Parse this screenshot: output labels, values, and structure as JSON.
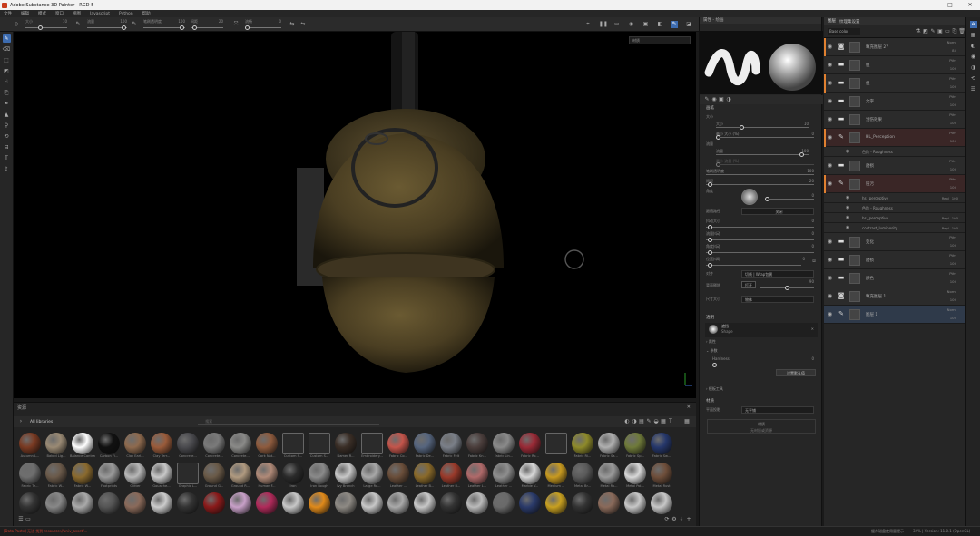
{
  "window": {
    "title": "Adobe Substance 3D Painter - RGD-5",
    "controls": [
      "—",
      "□",
      "✕"
    ]
  },
  "menu": [
    "文件",
    "编辑",
    "模式",
    "窗口",
    "视图",
    "Javascript",
    "Python",
    "帮助"
  ],
  "toolbar": {
    "sliders": [
      {
        "label": "大小",
        "value": "10"
      },
      {
        "label": "流量",
        "value": "100"
      },
      {
        "label": "笔刷透明度",
        "value": "100"
      },
      {
        "label": "间距",
        "value": "20"
      },
      {
        "label": "流畅",
        "value": "0"
      }
    ]
  },
  "viewport": {
    "dropdown": "材质"
  },
  "shelf": {
    "title": "资源",
    "library": "All libraries",
    "search_placeholder": "搜索",
    "row1": [
      {
        "label": "Autumn L...",
        "color": "#7a3a22"
      },
      {
        "label": "Baked Lig...",
        "color": "#9a8a74"
      },
      {
        "label": "Balance Contrast",
        "color": "#ffffff"
      },
      {
        "label": "Carbon Fi...",
        "color": "#111111"
      },
      {
        "label": "Clay Earl...",
        "color": "#8e6a4e"
      },
      {
        "label": "Clay Terr...",
        "color": "#9a5b3a"
      },
      {
        "label": "Concrete...",
        "color": "#4a4a4e"
      },
      {
        "label": "Concrete...",
        "color": "#7a7a7a"
      },
      {
        "label": "Concrete...",
        "color": "#8a8a88"
      },
      {
        "label": "Cork Nat...",
        "color": "#8e5b3e"
      },
      {
        "label": "Custom S...",
        "color": "#2b2b2b"
      },
      {
        "label": "Custom S...",
        "color": "#2b2b2b"
      },
      {
        "label": "Damer R...",
        "color": "#3a2e26"
      },
      {
        "label": "Embroidery...",
        "color": "#2b2b2b"
      },
      {
        "label": "Fabric Co...",
        "color": "#c4554b"
      },
      {
        "label": "Fabric De...",
        "color": "#56657e"
      },
      {
        "label": "Fabric Felt",
        "color": "#7a7f88"
      },
      {
        "label": "Fabric Kn...",
        "color": "#4b3e3c"
      },
      {
        "label": "Fabric Lin...",
        "color": "#8a8a8a"
      },
      {
        "label": "Fabric Ro...",
        "color": "#9a2a36"
      },
      {
        "label": "",
        "color": "#2b2b2b"
      },
      {
        "label": "Fabric Ri...",
        "color": "#8e8a2a"
      },
      {
        "label": "Fabric Sa...",
        "color": "#b0b0b0"
      },
      {
        "label": "Fabric Sp...",
        "color": "#6f7a3a"
      },
      {
        "label": "Fabric Sw...",
        "color": "#25376b"
      }
    ],
    "row2": [
      {
        "label": "Fabric Te...",
        "color": "#6e6e6e"
      },
      {
        "label": "Fabric W...",
        "color": "#6b5a4a"
      },
      {
        "label": "Fabric W...",
        "color": "#8a6a2e"
      },
      {
        "label": "Footprints",
        "color": "#9a9a9a"
      },
      {
        "label": "Glitter",
        "color": "#b8b8b8"
      },
      {
        "label": "Gouache...",
        "color": "#c8c8c8"
      },
      {
        "label": "Graphic L...",
        "color": "#2b2b2b"
      },
      {
        "label": "Ground G...",
        "color": "#6a5a48"
      },
      {
        "label": "Ground R...",
        "color": "#b09a80"
      },
      {
        "label": "Human F...",
        "color": "#b08a78"
      },
      {
        "label": "Iron",
        "color": "#2a2a2a"
      },
      {
        "label": "Iron Rough",
        "color": "#8a8a8a"
      },
      {
        "label": "Ivy Branch",
        "color": "#c8c8c8"
      },
      {
        "label": "Large Ro...",
        "color": "#a8a8a8"
      },
      {
        "label": "Leather ...",
        "color": "#6a4e3a"
      },
      {
        "label": "Leather B...",
        "color": "#8a6a2a"
      },
      {
        "label": "Leather R...",
        "color": "#9a3a2a"
      },
      {
        "label": "Leather L...",
        "color": "#b06a6a"
      },
      {
        "label": "Leather ...",
        "color": "#8e8e8e"
      },
      {
        "label": "Marble V...",
        "color": "#d8d8d8"
      },
      {
        "label": "Medium ...",
        "color": "#c89a20"
      },
      {
        "label": "Metal Br...",
        "color": "#5a5a5a"
      },
      {
        "label": "Metal Ro...",
        "color": "#9a9a9a"
      },
      {
        "label": "Metal Pol...",
        "color": "#d8d8d8"
      },
      {
        "label": "Metal Rust",
        "color": "#6e4e3a"
      }
    ],
    "row3": [
      {
        "color": "#333333"
      },
      {
        "color": "#888888"
      },
      {
        "color": "#aaaaaa"
      },
      {
        "color": "#555555"
      },
      {
        "color": "#8a6a5a"
      },
      {
        "color": "#cccccc"
      },
      {
        "color": "#333333"
      },
      {
        "color": "#8a1a1a"
      },
      {
        "color": "#c8a0c8"
      },
      {
        "color": "#b02a5a"
      },
      {
        "color": "#c8c8c8"
      },
      {
        "color": "#e08a1a"
      },
      {
        "color": "#8e8a84"
      },
      {
        "color": "#c8c8c8"
      },
      {
        "color": "#aaaaaa"
      },
      {
        "color": "#c8c8c8"
      },
      {
        "color": "#333333"
      },
      {
        "color": "#bbbbbb"
      },
      {
        "color": "#6a6a6a"
      },
      {
        "color": "#2a3a6a"
      },
      {
        "color": "#c8a020"
      },
      {
        "color": "#333333"
      },
      {
        "color": "#8a6a5a"
      },
      {
        "color": "#c8c8c8"
      },
      {
        "color": "#c8c8c8"
      }
    ]
  },
  "status": {
    "left": "[Data Paste] 无法 找到 resource://univ_asset/...",
    "right1": "缓存磁盘使用量提示",
    "right2": "32% | Version: 11.0.1 (OpenGL)"
  },
  "properties": {
    "header": "属性 - 绘画",
    "section_brush": "画笔",
    "size_label": "大小",
    "size_row": {
      "k": "大小",
      "v": "10"
    },
    "size_jitter": {
      "k": "最小 大小 (%)",
      "v": "0"
    },
    "flow_label": "流量",
    "flow_row": {
      "k": "流量",
      "v": "100"
    },
    "flow_jitter": {
      "k": "最小 流量 (%)",
      "v": ""
    },
    "opacity": {
      "k": "笔刷透明度",
      "v": "100"
    },
    "spacing": {
      "k": "间距",
      "v": "20"
    },
    "angle": {
      "k": "角度",
      "v": "0"
    },
    "follow_path": {
      "k": "跟随路径",
      "v": "关闭"
    },
    "size_jitter2": {
      "k": "抖动大小",
      "v": "0"
    },
    "flow_jitter2": {
      "k": "流量抖动",
      "v": "0"
    },
    "angle_jitter": {
      "k": "角度抖动",
      "v": "0"
    },
    "pos_jitter": {
      "k": "位置抖动",
      "v": "0"
    },
    "alignment": {
      "k": "对齐",
      "v": "切线 | Wrap包裹"
    },
    "backface": {
      "k": "背面剔除",
      "v": "90",
      "btn": "打开"
    },
    "size_space": {
      "k": "尺寸大小",
      "v": "物体"
    },
    "alpha_section": "透明",
    "alpha_name": "遮挡",
    "alpha_sub": "Shape",
    "attr_label": "属性",
    "params_label": "参数",
    "hardness": {
      "k": "Hardness",
      "v": "0"
    },
    "reset_btn": "设置默认值",
    "stencil": "模板工具",
    "material_section": "材质",
    "material_mode": {
      "k": "平面投影",
      "v": "无平铺"
    },
    "material_drop": "材质",
    "material_drop_sub": "无材质或资源"
  },
  "layers": {
    "tabs": [
      "图层",
      "纹理集设置"
    ],
    "blend": "Base color",
    "items": [
      {
        "name": "填充图层 27",
        "blend": "Norm",
        "op": "85",
        "icon": "fill",
        "stripe": "#e08030"
      },
      {
        "name": "组",
        "blend": "Pthr",
        "op": "100",
        "icon": "folder",
        "stripe": ""
      },
      {
        "name": "组",
        "blend": "Pthr",
        "op": "100",
        "icon": "folder",
        "stripe": "#e08030"
      },
      {
        "name": "文字",
        "blend": "Pthr",
        "op": "100",
        "icon": "folder",
        "stripe": ""
      },
      {
        "name": "划伤效果",
        "blend": "Pthr",
        "op": "100",
        "icon": "folder",
        "stripe": ""
      }
    ],
    "paint1": {
      "name": "HL_Perception",
      "blend": "Pthr",
      "op": "100"
    },
    "paint1_sub": {
      "name": "色阶 - Roughness",
      "blend": "",
      "op": ""
    },
    "group_wear": {
      "name": "磨损",
      "blend": "Pthr",
      "op": "100"
    },
    "paint2": {
      "name": "脏污",
      "blend": "Pthr",
      "op": "100"
    },
    "subs": [
      {
        "name": "hsl_perceptive",
        "blend": "Repl",
        "op": "100"
      },
      {
        "name": "色阶 - Roughness",
        "blend": "",
        "op": ""
      },
      {
        "name": "hsl_perceptive",
        "blend": "Repl",
        "op": "100"
      },
      {
        "name": "contrast_luminosity",
        "blend": "Repl",
        "op": "100"
      }
    ],
    "tail": [
      {
        "name": "变化",
        "blend": "Pthr",
        "op": "100",
        "icon": "folder"
      },
      {
        "name": "磨损",
        "blend": "Pthr",
        "op": "100",
        "icon": "folder"
      },
      {
        "name": "颜色",
        "blend": "Pthr",
        "op": "100",
        "icon": "folder"
      },
      {
        "name": "填充图层 1",
        "blend": "Norm",
        "op": "100",
        "icon": "fill"
      },
      {
        "name": "图层 1",
        "blend": "Norm",
        "op": "100",
        "icon": "paint"
      }
    ]
  }
}
